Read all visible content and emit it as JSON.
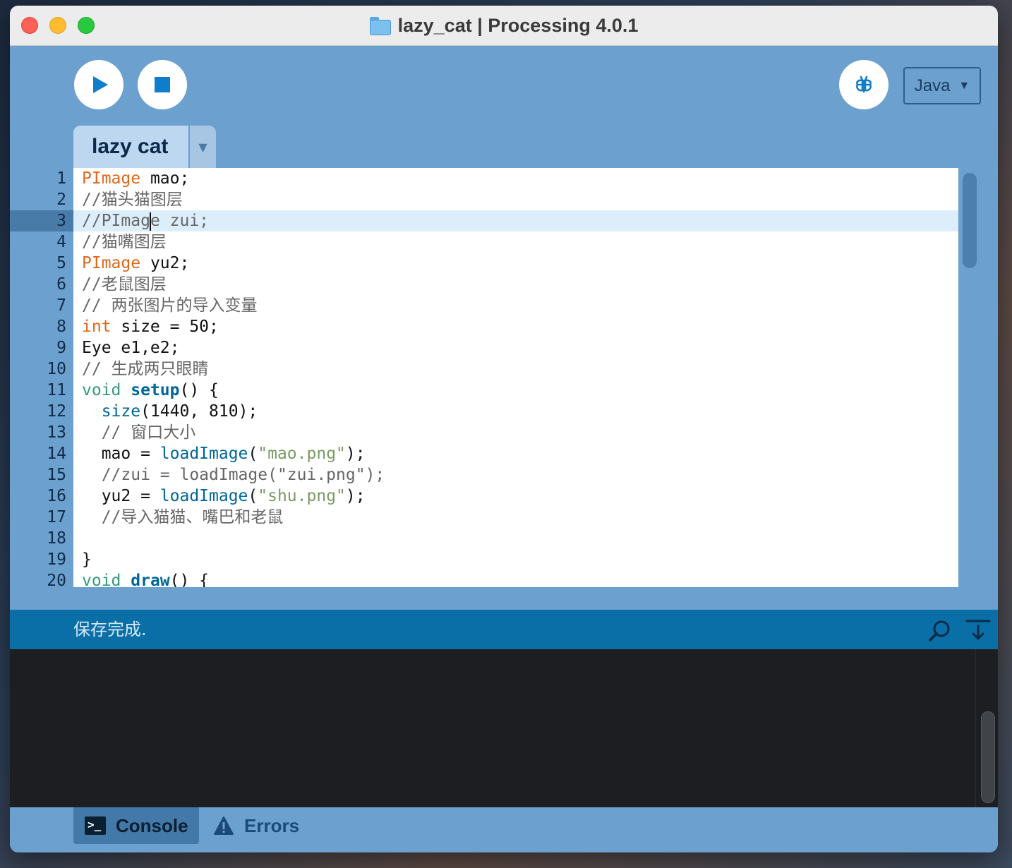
{
  "window": {
    "title": "lazy_cat | Processing 4.0.1"
  },
  "toolbar": {
    "mode": "Java",
    "mode_caret": "▼"
  },
  "tabs": {
    "sketch_tab": "lazy cat",
    "menu_caret": "▼"
  },
  "editor": {
    "current_line": 3,
    "lines": [
      {
        "no": "1",
        "tokens": [
          {
            "t": "PImage",
            "c": "type"
          },
          {
            "t": " mao;",
            "c": "plain"
          }
        ]
      },
      {
        "no": "2",
        "tokens": [
          {
            "t": "//猫头猫图层",
            "c": "comment"
          }
        ]
      },
      {
        "no": "3",
        "tokens": [
          {
            "t": "//PImag",
            "c": "comment"
          },
          {
            "t": "",
            "c": "caret"
          },
          {
            "t": "e zui;",
            "c": "comment"
          }
        ]
      },
      {
        "no": "4",
        "tokens": [
          {
            "t": "//猫嘴图层",
            "c": "comment"
          }
        ]
      },
      {
        "no": "5",
        "tokens": [
          {
            "t": "PImage",
            "c": "type"
          },
          {
            "t": " yu2;",
            "c": "plain"
          }
        ]
      },
      {
        "no": "6",
        "tokens": [
          {
            "t": "//老鼠图层",
            "c": "comment"
          }
        ]
      },
      {
        "no": "7",
        "tokens": [
          {
            "t": "// 两张图片的导入变量",
            "c": "comment"
          }
        ]
      },
      {
        "no": "8",
        "tokens": [
          {
            "t": "int",
            "c": "type"
          },
          {
            "t": " size = 50;",
            "c": "plain"
          }
        ]
      },
      {
        "no": "9",
        "tokens": [
          {
            "t": "Eye e1,e2;",
            "c": "plain"
          }
        ]
      },
      {
        "no": "10",
        "tokens": [
          {
            "t": "// 生成两只眼睛",
            "c": "comment"
          }
        ]
      },
      {
        "no": "11",
        "tokens": [
          {
            "t": "void",
            "c": "keyword"
          },
          {
            "t": " ",
            "c": "plain"
          },
          {
            "t": "setup",
            "c": "func"
          },
          {
            "t": "() {",
            "c": "plain"
          }
        ]
      },
      {
        "no": "12",
        "tokens": [
          {
            "t": "  ",
            "c": "plain"
          },
          {
            "t": "size",
            "c": "builtin"
          },
          {
            "t": "(1440, 810);",
            "c": "plain"
          }
        ]
      },
      {
        "no": "13",
        "tokens": [
          {
            "t": "  // 窗口大小",
            "c": "comment"
          }
        ]
      },
      {
        "no": "14",
        "tokens": [
          {
            "t": "  mao = ",
            "c": "plain"
          },
          {
            "t": "loadImage",
            "c": "builtin"
          },
          {
            "t": "(",
            "c": "plain"
          },
          {
            "t": "\"mao.png\"",
            "c": "str"
          },
          {
            "t": ");",
            "c": "plain"
          }
        ]
      },
      {
        "no": "15",
        "tokens": [
          {
            "t": "  //zui = loadImage(\"zui.png\");",
            "c": "comment"
          }
        ]
      },
      {
        "no": "16",
        "tokens": [
          {
            "t": "  yu2 = ",
            "c": "plain"
          },
          {
            "t": "loadImage",
            "c": "builtin"
          },
          {
            "t": "(",
            "c": "plain"
          },
          {
            "t": "\"shu.png\"",
            "c": "str"
          },
          {
            "t": ");",
            "c": "plain"
          }
        ]
      },
      {
        "no": "17",
        "tokens": [
          {
            "t": "  //导入猫猫、嘴巴和老鼠",
            "c": "comment"
          }
        ]
      },
      {
        "no": "18",
        "tokens": []
      },
      {
        "no": "19",
        "tokens": [
          {
            "t": "}",
            "c": "plain"
          }
        ]
      },
      {
        "no": "20",
        "tokens": [
          {
            "t": "void",
            "c": "keyword"
          },
          {
            "t": " ",
            "c": "plain"
          },
          {
            "t": "draw",
            "c": "func"
          },
          {
            "t": "() {",
            "c": "plain"
          }
        ]
      }
    ]
  },
  "status": {
    "message": "保存完成."
  },
  "bottom_tabs": {
    "console": "Console",
    "errors": "Errors"
  },
  "colors": {
    "window_bg": "#6ba0cf",
    "accent": "#0f7ccc",
    "status_bar": "#0a6fa6",
    "console_bg": "#1c1e21"
  },
  "icons": {
    "run": "play-icon",
    "stop": "stop-icon",
    "debug": "butterfly-debug-icon",
    "search": "search-icon",
    "clear": "clear-console-icon",
    "console": "terminal-icon",
    "errors": "warning-icon",
    "folder": "folder-icon"
  }
}
